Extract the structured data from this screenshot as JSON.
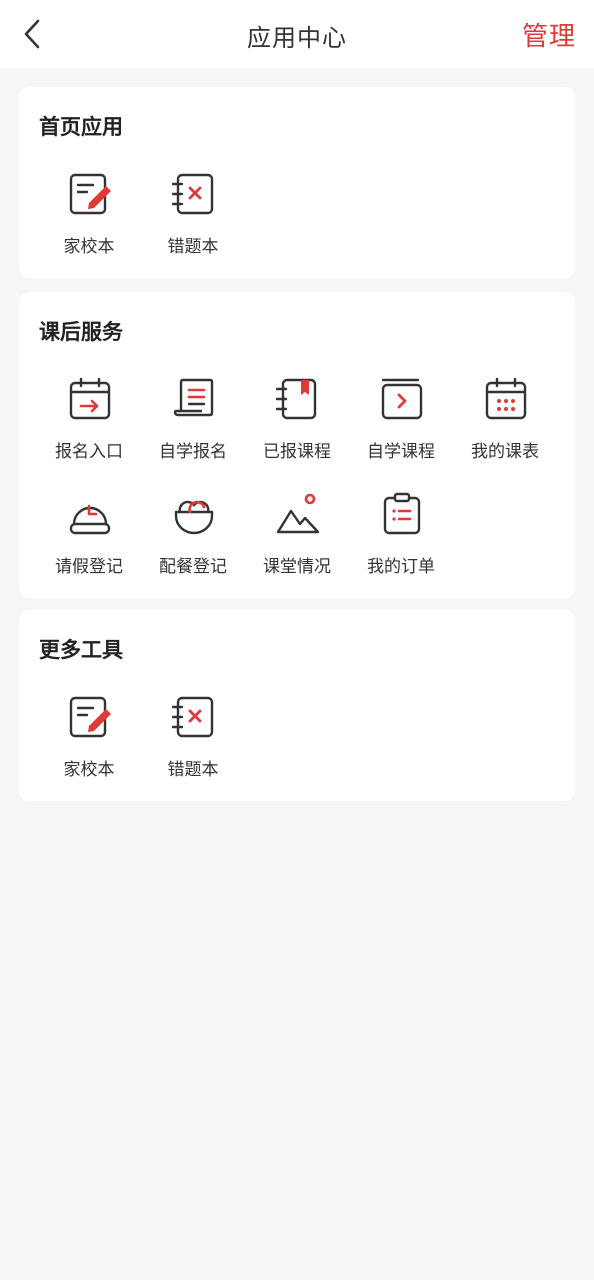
{
  "header": {
    "title": "应用中心",
    "manage_label": "管理"
  },
  "colors": {
    "accent": "#e03a36",
    "icon_stroke": "#333333",
    "background": "#f6f6f6",
    "card": "#ffffff"
  },
  "sections": [
    {
      "title": "首页应用",
      "items": [
        {
          "label": "家校本",
          "icon": "notebook-pencil-icon"
        },
        {
          "label": "错题本",
          "icon": "wrong-question-book-icon"
        }
      ]
    },
    {
      "title": "课后服务",
      "items": [
        {
          "label": "报名入口",
          "icon": "calendar-arrow-icon"
        },
        {
          "label": "自学报名",
          "icon": "scroll-document-icon"
        },
        {
          "label": "已报课程",
          "icon": "bookmark-book-icon"
        },
        {
          "label": "自学课程",
          "icon": "folder-play-icon"
        },
        {
          "label": "我的课表",
          "icon": "calendar-grid-icon"
        },
        {
          "label": "请假登记",
          "icon": "clock-dome-icon"
        },
        {
          "label": "配餐登记",
          "icon": "food-bowl-icon"
        },
        {
          "label": "课堂情况",
          "icon": "mountain-landscape-icon"
        },
        {
          "label": "我的订单",
          "icon": "clipboard-list-icon"
        }
      ]
    },
    {
      "title": "更多工具",
      "items": [
        {
          "label": "家校本",
          "icon": "notebook-pencil-icon"
        },
        {
          "label": "错题本",
          "icon": "wrong-question-book-icon"
        }
      ]
    }
  ]
}
